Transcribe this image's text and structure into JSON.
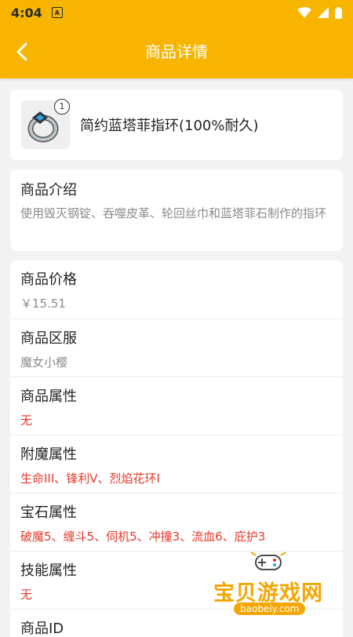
{
  "status_bar": {
    "time": "4:04",
    "sim_label": "A"
  },
  "header": {
    "title": "商品详情",
    "back_icon": "chevron-left-icon"
  },
  "product": {
    "quantity": "1",
    "name": "简约蓝塔菲指环(100%耐久)",
    "icon": "ring-icon"
  },
  "intro": {
    "label": "商品介绍",
    "description": "使用毁灭钢锭、吞噬皮革、轮回丝巾和蓝塔菲石制作的指环"
  },
  "details": [
    {
      "label": "商品价格",
      "value": "￥15.51",
      "highlight": false
    },
    {
      "label": "商品区服",
      "value": "魔女小樱",
      "highlight": false
    },
    {
      "label": "商品属性",
      "value": "无",
      "highlight": true
    },
    {
      "label": "附魔属性",
      "value": "生命III、锋利V、烈焰花环I",
      "highlight": true
    },
    {
      "label": "宝石属性",
      "value": "破魔5、缠斗5、伺机5、冲撞3、流血6、庇护3",
      "highlight": true
    },
    {
      "label": "技能属性",
      "value": "无",
      "highlight": true
    },
    {
      "label": "商品ID",
      "value": "",
      "highlight": false
    }
  ],
  "watermark": {
    "name": "宝贝游戏网",
    "url": "baobeiy.com"
  },
  "colors": {
    "accent": "#f7b500",
    "highlight": "#e8382c",
    "muted": "#8a8a8a",
    "background": "#f2f2f2"
  }
}
